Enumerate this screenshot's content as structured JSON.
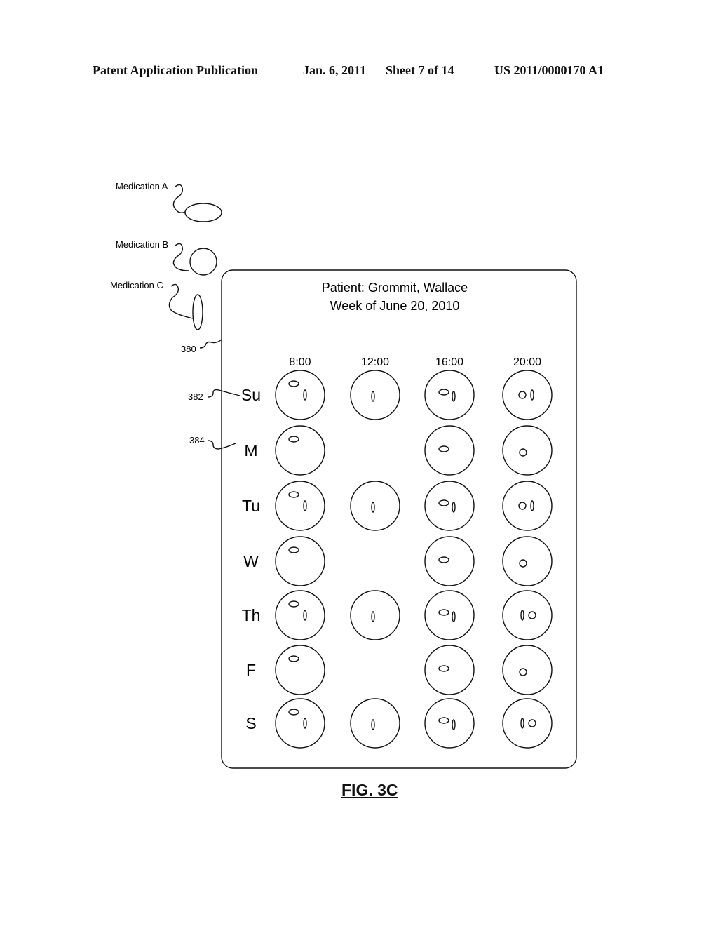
{
  "header": {
    "publication": "Patent Application Publication",
    "date": "Jan. 6, 2011",
    "sheet": "Sheet 7 of 14",
    "number": "US 2011/0000170 A1"
  },
  "legend": [
    {
      "label": "Medication A",
      "shape": "horizontal-oval"
    },
    {
      "label": "Medication B",
      "shape": "circle"
    },
    {
      "label": "Medication C",
      "shape": "vertical-oval"
    }
  ],
  "card": {
    "patient_line": "Patient: Grommit, Wallace",
    "week_line": "Week of June 20, 2010",
    "ref_card": "380",
    "ref_row_su": "382",
    "ref_row_m": "384"
  },
  "times": [
    "8:00",
    "12:00",
    "16:00",
    "20:00"
  ],
  "days": [
    "Su",
    "M",
    "Tu",
    "W",
    "Th",
    "F",
    "S"
  ],
  "schedule": [
    [
      [
        "A",
        "C"
      ],
      [
        "C"
      ],
      [
        "A",
        "C"
      ],
      [
        "B",
        "C"
      ]
    ],
    [
      [
        "A"
      ],
      null,
      [
        "A"
      ],
      [
        "B"
      ]
    ],
    [
      [
        "A",
        "C"
      ],
      [
        "C"
      ],
      [
        "A",
        "C"
      ],
      [
        "B",
        "C"
      ]
    ],
    [
      [
        "A"
      ],
      null,
      [
        "A"
      ],
      [
        "B"
      ]
    ],
    [
      [
        "A",
        "C"
      ],
      [
        "C"
      ],
      [
        "A",
        "C"
      ],
      [
        "C",
        "B"
      ]
    ],
    [
      [
        "A"
      ],
      null,
      [
        "A"
      ],
      [
        "B"
      ]
    ],
    [
      [
        "A",
        "C"
      ],
      [
        "C"
      ],
      [
        "A",
        "C"
      ],
      [
        "C",
        "B"
      ]
    ]
  ],
  "figure_label": "FIG. 3C"
}
